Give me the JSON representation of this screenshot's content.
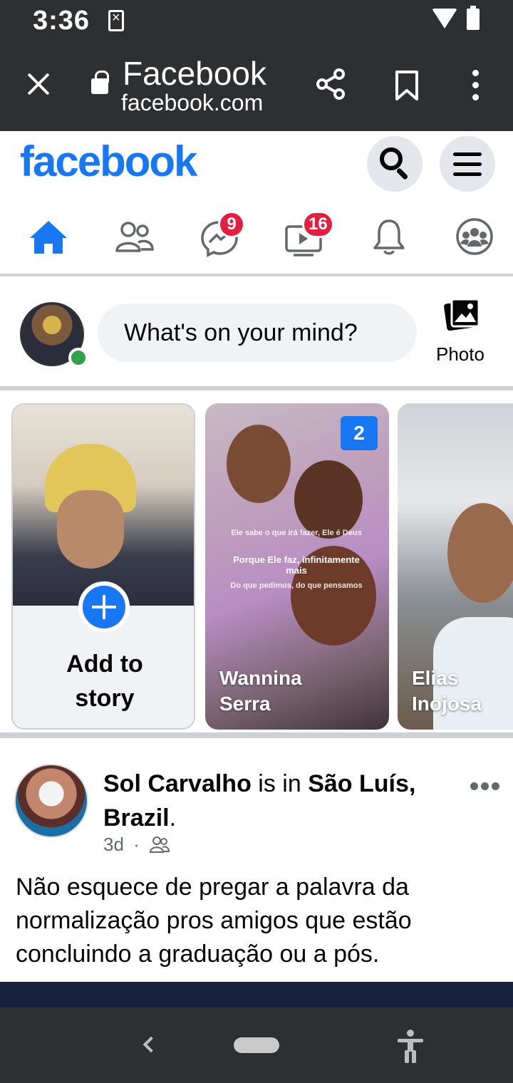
{
  "status_bar": {
    "time": "3:36"
  },
  "browser": {
    "title": "Facebook",
    "url": "facebook.com"
  },
  "facebook": {
    "logo": "facebook"
  },
  "nav": {
    "home_color": "#1877f2",
    "messenger_badge": "9",
    "watch_badge": "16"
  },
  "composer": {
    "placeholder": "What's on your mind?",
    "photo_label": "Photo"
  },
  "stories": {
    "add_story": {
      "line1": "Add to",
      "line2": "story"
    },
    "items": [
      {
        "name_line1": "Wannina",
        "name_line2": "Serra",
        "count": "2",
        "overlay_line1": "Ele sabe o que irá fazer, Ele é Deus",
        "overlay_line2": "Porque Ele faz, infinitamente mais",
        "overlay_line3": "Do que pedimos, do que pensamos"
      },
      {
        "name_line1": "Elias",
        "name_line2": "Inojosa"
      }
    ]
  },
  "post": {
    "author": "Sol Carvalho",
    "is_in": " is in ",
    "place": "São Luís, Brazil",
    "period": ".",
    "time": "3d",
    "separator": "·",
    "text": "Não esquece de pregar a palavra da normalização pros amigos que estão concluindo a graduação ou a pós."
  },
  "colors": {
    "brand": "#1877f2",
    "badge": "#e41e3f",
    "online": "#31a24c"
  }
}
